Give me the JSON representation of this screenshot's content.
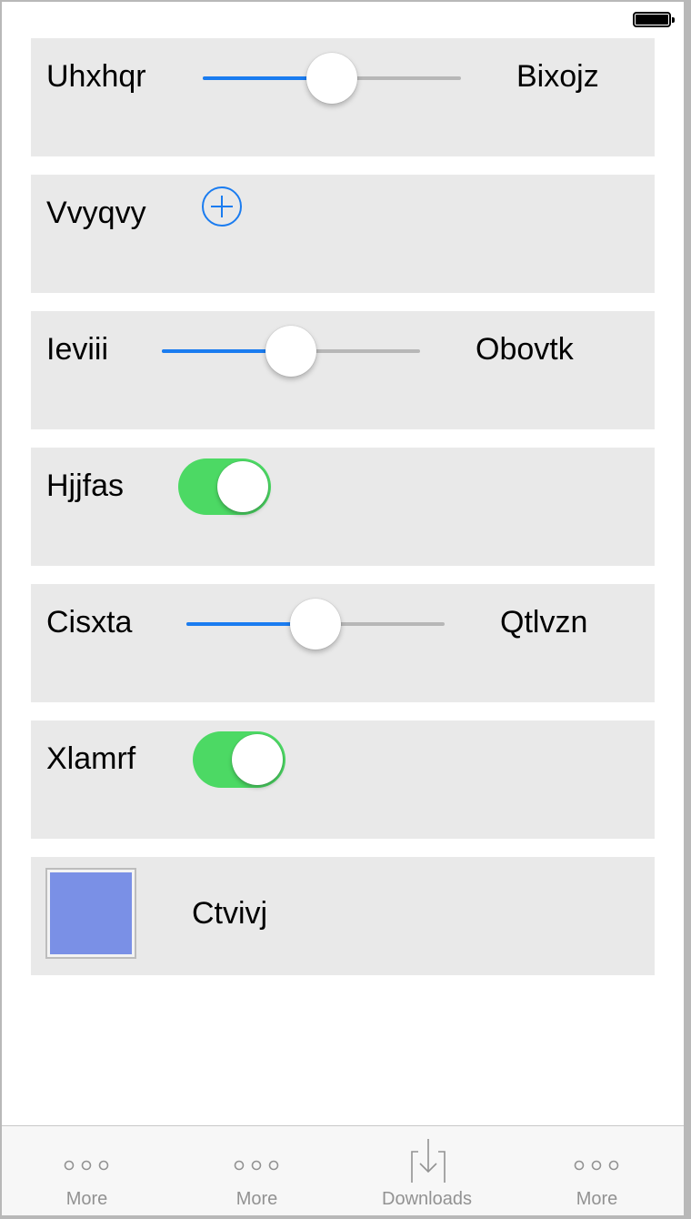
{
  "colors": {
    "accent": "#1a7cf0",
    "toggle_on": "#4cd964",
    "row_bg": "#e9e9e9",
    "tab_inactive": "#929292"
  },
  "rows": [
    {
      "type": "slider",
      "label": "Uhxhqr",
      "right_label": "Bixojz",
      "value": 0.5
    },
    {
      "type": "add",
      "label": "Vvyqvy",
      "icon": "plus-circle-icon"
    },
    {
      "type": "slider",
      "label": "Ieviii",
      "right_label": "Obovtk",
      "value": 0.5
    },
    {
      "type": "toggle",
      "label": "Hjjfas",
      "on": true
    },
    {
      "type": "slider",
      "label": "Cisxta",
      "right_label": "Qtlvzn",
      "value": 0.5
    },
    {
      "type": "toggle",
      "label": "Xlamrf",
      "on": true
    },
    {
      "type": "color",
      "label": "Ctvivj",
      "color": "#7a90e6"
    }
  ],
  "tabbar": {
    "tabs": [
      {
        "label": "More",
        "icon": "more-icon"
      },
      {
        "label": "More",
        "icon": "more-icon"
      },
      {
        "label": "Downloads",
        "icon": "downloads-icon"
      },
      {
        "label": "More",
        "icon": "more-icon"
      }
    ]
  }
}
